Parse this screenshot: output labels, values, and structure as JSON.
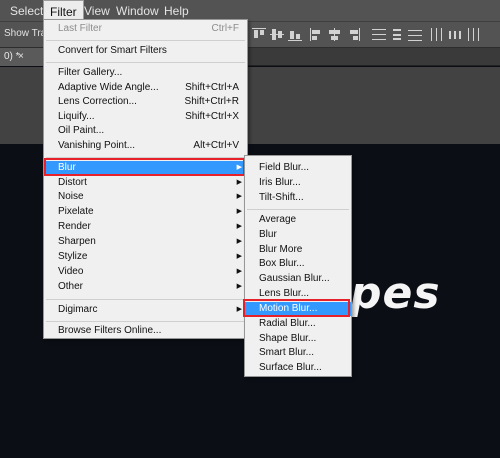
{
  "menubar": {
    "items": [
      {
        "label": "Select"
      },
      {
        "label": "Filter"
      },
      {
        "label": "View"
      },
      {
        "label": "Window"
      },
      {
        "label": "Help"
      }
    ]
  },
  "options_bar": {
    "label": "Show Tran"
  },
  "document_tab": {
    "label": "0) *",
    "close": "×"
  },
  "canvas_text": "pes",
  "filter_menu": {
    "last_filter": {
      "label": "Last Filter",
      "shortcut": "Ctrl+F"
    },
    "convert_smart": {
      "label": "Convert for Smart Filters"
    },
    "filter_gallery": {
      "label": "Filter Gallery..."
    },
    "adaptive_wide": {
      "label": "Adaptive Wide Angle...",
      "shortcut": "Shift+Ctrl+A"
    },
    "lens_correction": {
      "label": "Lens Correction...",
      "shortcut": "Shift+Ctrl+R"
    },
    "liquify": {
      "label": "Liquify...",
      "shortcut": "Shift+Ctrl+X"
    },
    "oil_paint": {
      "label": "Oil Paint..."
    },
    "vanishing_point": {
      "label": "Vanishing Point...",
      "shortcut": "Alt+Ctrl+V"
    },
    "categories": [
      {
        "label": "Blur"
      },
      {
        "label": "Distort"
      },
      {
        "label": "Noise"
      },
      {
        "label": "Pixelate"
      },
      {
        "label": "Render"
      },
      {
        "label": "Sharpen"
      },
      {
        "label": "Stylize"
      },
      {
        "label": "Video"
      },
      {
        "label": "Other"
      }
    ],
    "digimarc": {
      "label": "Digimarc"
    },
    "browse_online": {
      "label": "Browse Filters Online..."
    }
  },
  "blur_menu": {
    "items": [
      {
        "label": "Field Blur..."
      },
      {
        "label": "Iris Blur..."
      },
      {
        "label": "Tilt-Shift..."
      },
      {
        "label": "Average"
      },
      {
        "label": "Blur"
      },
      {
        "label": "Blur More"
      },
      {
        "label": "Box Blur..."
      },
      {
        "label": "Gaussian Blur..."
      },
      {
        "label": "Lens Blur..."
      },
      {
        "label": "Motion Blur..."
      },
      {
        "label": "Radial Blur..."
      },
      {
        "label": "Shape Blur..."
      },
      {
        "label": "Smart Blur..."
      },
      {
        "label": "Surface Blur..."
      }
    ]
  },
  "colors": {
    "highlight": "#3399ff",
    "annotation_outline": "#e8202a",
    "menu_background": "#f0f0f0",
    "canvas_background": "#0b0f15"
  }
}
